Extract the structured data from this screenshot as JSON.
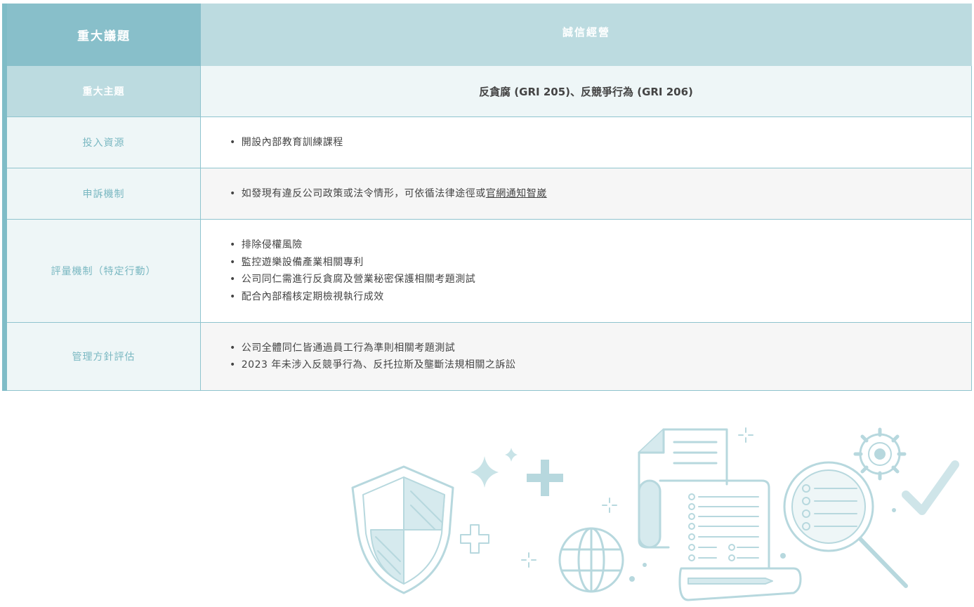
{
  "table": {
    "header": {
      "col1": "重大議題",
      "col2": "誠信經營"
    },
    "subheader": {
      "col1": "重大主題",
      "col2": "反貪腐 (GRI 205)、反競爭行為 (GRI 206)"
    },
    "rows": [
      {
        "label": "投入資源",
        "items": [
          "開設內部教育訓練課程"
        ]
      },
      {
        "label": "申訴機制",
        "items_text": "如發現有違反公司政策或法令情形，可依循法律途徑或",
        "link_text": "官網通知智崴 "
      },
      {
        "label": "評量機制（特定行動）",
        "items": [
          "排除侵權風險",
          "監控遊樂設備產業相關專利",
          "公司同仁需進行反貪腐及營業秘密保護相關考題測試",
          "配合內部稽核定期檢視執行成效"
        ]
      },
      {
        "label": "管理方針評估",
        "items": [
          "公司全體同仁皆通過員工行為準則相關考題測試",
          "2023 年未涉入反競爭行為、反托拉斯及壟斷法規相關之訴訟"
        ]
      }
    ]
  },
  "colors": {
    "accent": "#88bfca",
    "light": "#bcdbe0",
    "pale": "#eef6f7",
    "label_text": "#7ab8c2",
    "illustration": "#b7d8de"
  },
  "illustration": {
    "icons": [
      "shield-icon",
      "sparkle-icon",
      "plus-icon",
      "globe-icon",
      "document-scroll-icon",
      "magnifier-icon",
      "gear-icon",
      "checkmark-icon"
    ]
  }
}
